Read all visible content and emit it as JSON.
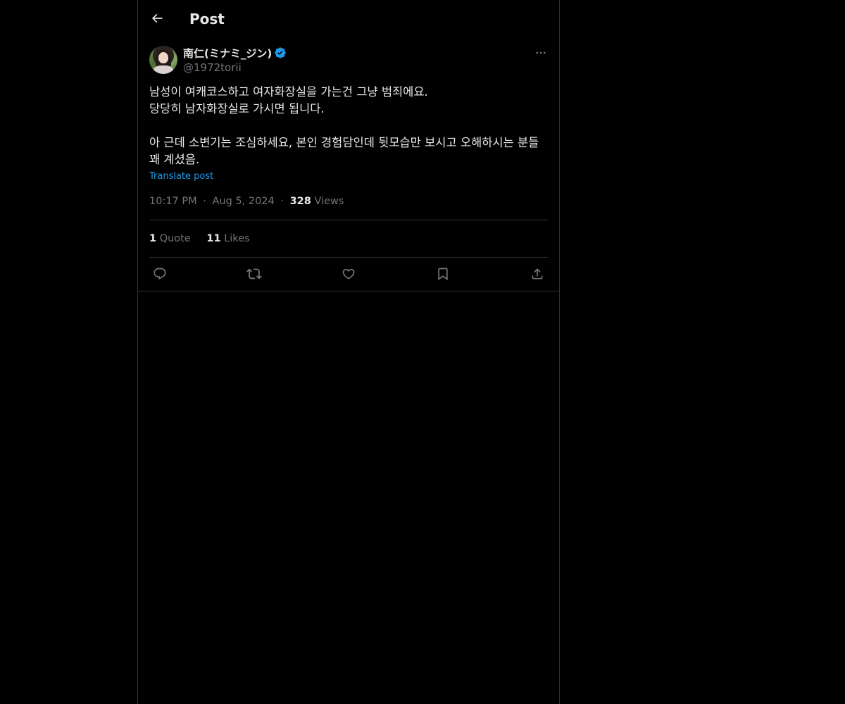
{
  "header": {
    "title": "Post",
    "back_icon": "arrow-left-icon"
  },
  "post": {
    "author": {
      "display_name": "南仁(ミナミ_ジン)",
      "handle": "@1972torii",
      "verified": true
    },
    "text": "남성이 여캐코스하고 여자화장실을 가는건 그냥 범죄에요.\n당당히 남자화장실로 가시면 됩니다.\n\n아 근데 소변기는 조심하세요, 본인 경험담인데 뒷모습만 보시고 오해하시는 분들 꽤 계셨음.",
    "translate_label": "Translate post",
    "time": "10:17 PM",
    "date": "Aug 5, 2024",
    "views_count": "328",
    "views_label": "Views",
    "separator": "·"
  },
  "stats": {
    "quotes_count": "1",
    "quotes_label": "Quote",
    "likes_count": "11",
    "likes_label": "Likes"
  },
  "actions": [
    "reply-icon",
    "repost-icon",
    "like-icon",
    "bookmark-icon",
    "share-icon"
  ],
  "colors": {
    "background": "#000000",
    "text": "#e7e9ea",
    "muted": "#71767b",
    "border": "#2f3336",
    "accent": "#1d9bf0"
  }
}
